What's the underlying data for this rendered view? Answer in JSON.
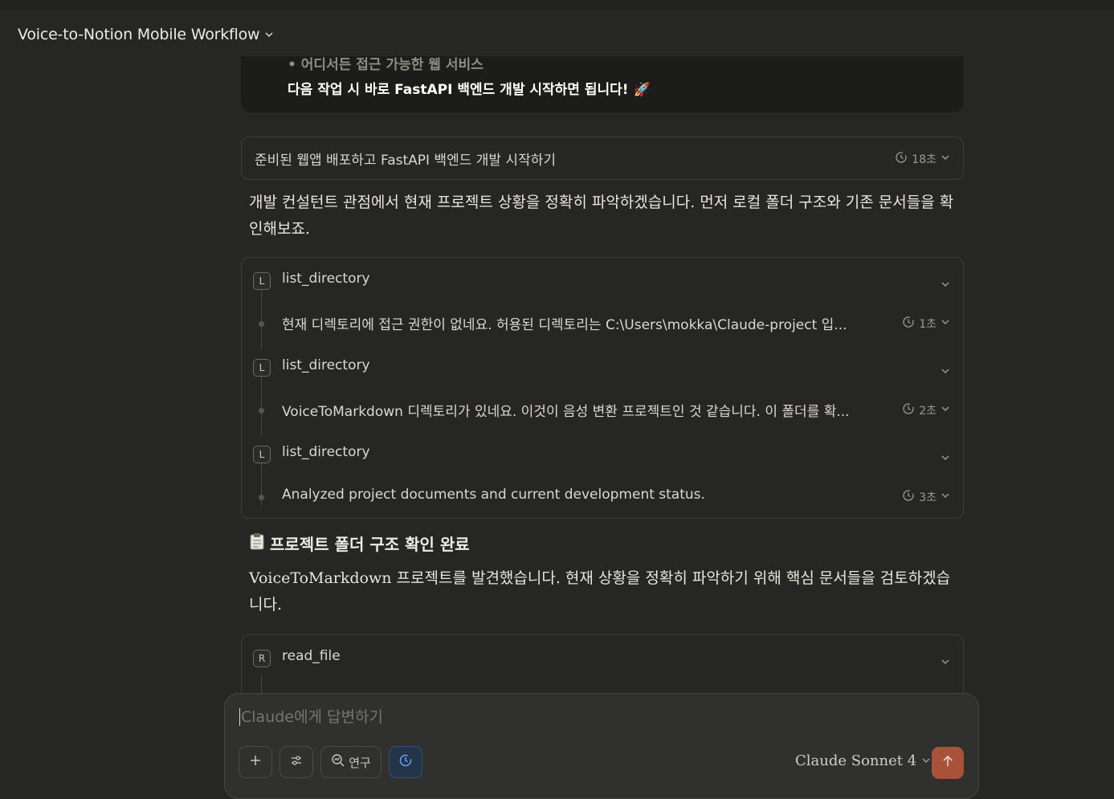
{
  "header": {
    "title": "Voice-to-Notion Mobile Workflow"
  },
  "prev_card": {
    "line1": "• 어디서든 접근 가능한 웹 서비스",
    "line2": "다음 작업 시 바로 FastAPI 백엔드 개발 시작하면 됩니다! 🚀"
  },
  "user_message": {
    "text": "준비된 웹앱 배포하고 FastAPI 백엔드 개발 시작하기",
    "time": "18초"
  },
  "assistant": {
    "para1": "개발 컨설턴트 관점에서 현재 프로젝트 상황을 정확히 파악하겠습니다. 먼저 로컬 폴더 구조와 기존 문서들을 확인해보죠.",
    "heading": "프로젝트 폴더 구조 확인 완료",
    "heading_icon": "clipboard-emoji",
    "para2": "VoiceToMarkdown 프로젝트를 발견했습니다. 현재 상황을 정확히 파악하기 위해 핵심 문서들을 검토하겠습니다."
  },
  "tool_calls": [
    {
      "badge": "L",
      "name": "list_directory",
      "summary": "현재 디렉토리에 접근 권한이 없네요. 허용된 디렉토리는 C:\\Users\\mokka\\Claude-project 입...",
      "time": "1초"
    },
    {
      "badge": "L",
      "name": "list_directory",
      "summary": "VoiceToMarkdown 디렉토리가 있네요. 이것이 음성 변환 프로젝트인 것 같습니다. 이 폴더를 확...",
      "time": "2초"
    },
    {
      "badge": "L",
      "name": "list_directory",
      "summary": "Analyzed project documents and current development status.",
      "time": "3초"
    }
  ],
  "tool_call2": {
    "badge": "R",
    "name": "read_file"
  },
  "composer": {
    "placeholder": "Claude에게 답변하기",
    "research_label": "연구",
    "model": "Claude Sonnet 4"
  },
  "colors": {
    "background": "#262624",
    "send_button": "#a8523a",
    "active_tool": "#6aa4f4"
  }
}
